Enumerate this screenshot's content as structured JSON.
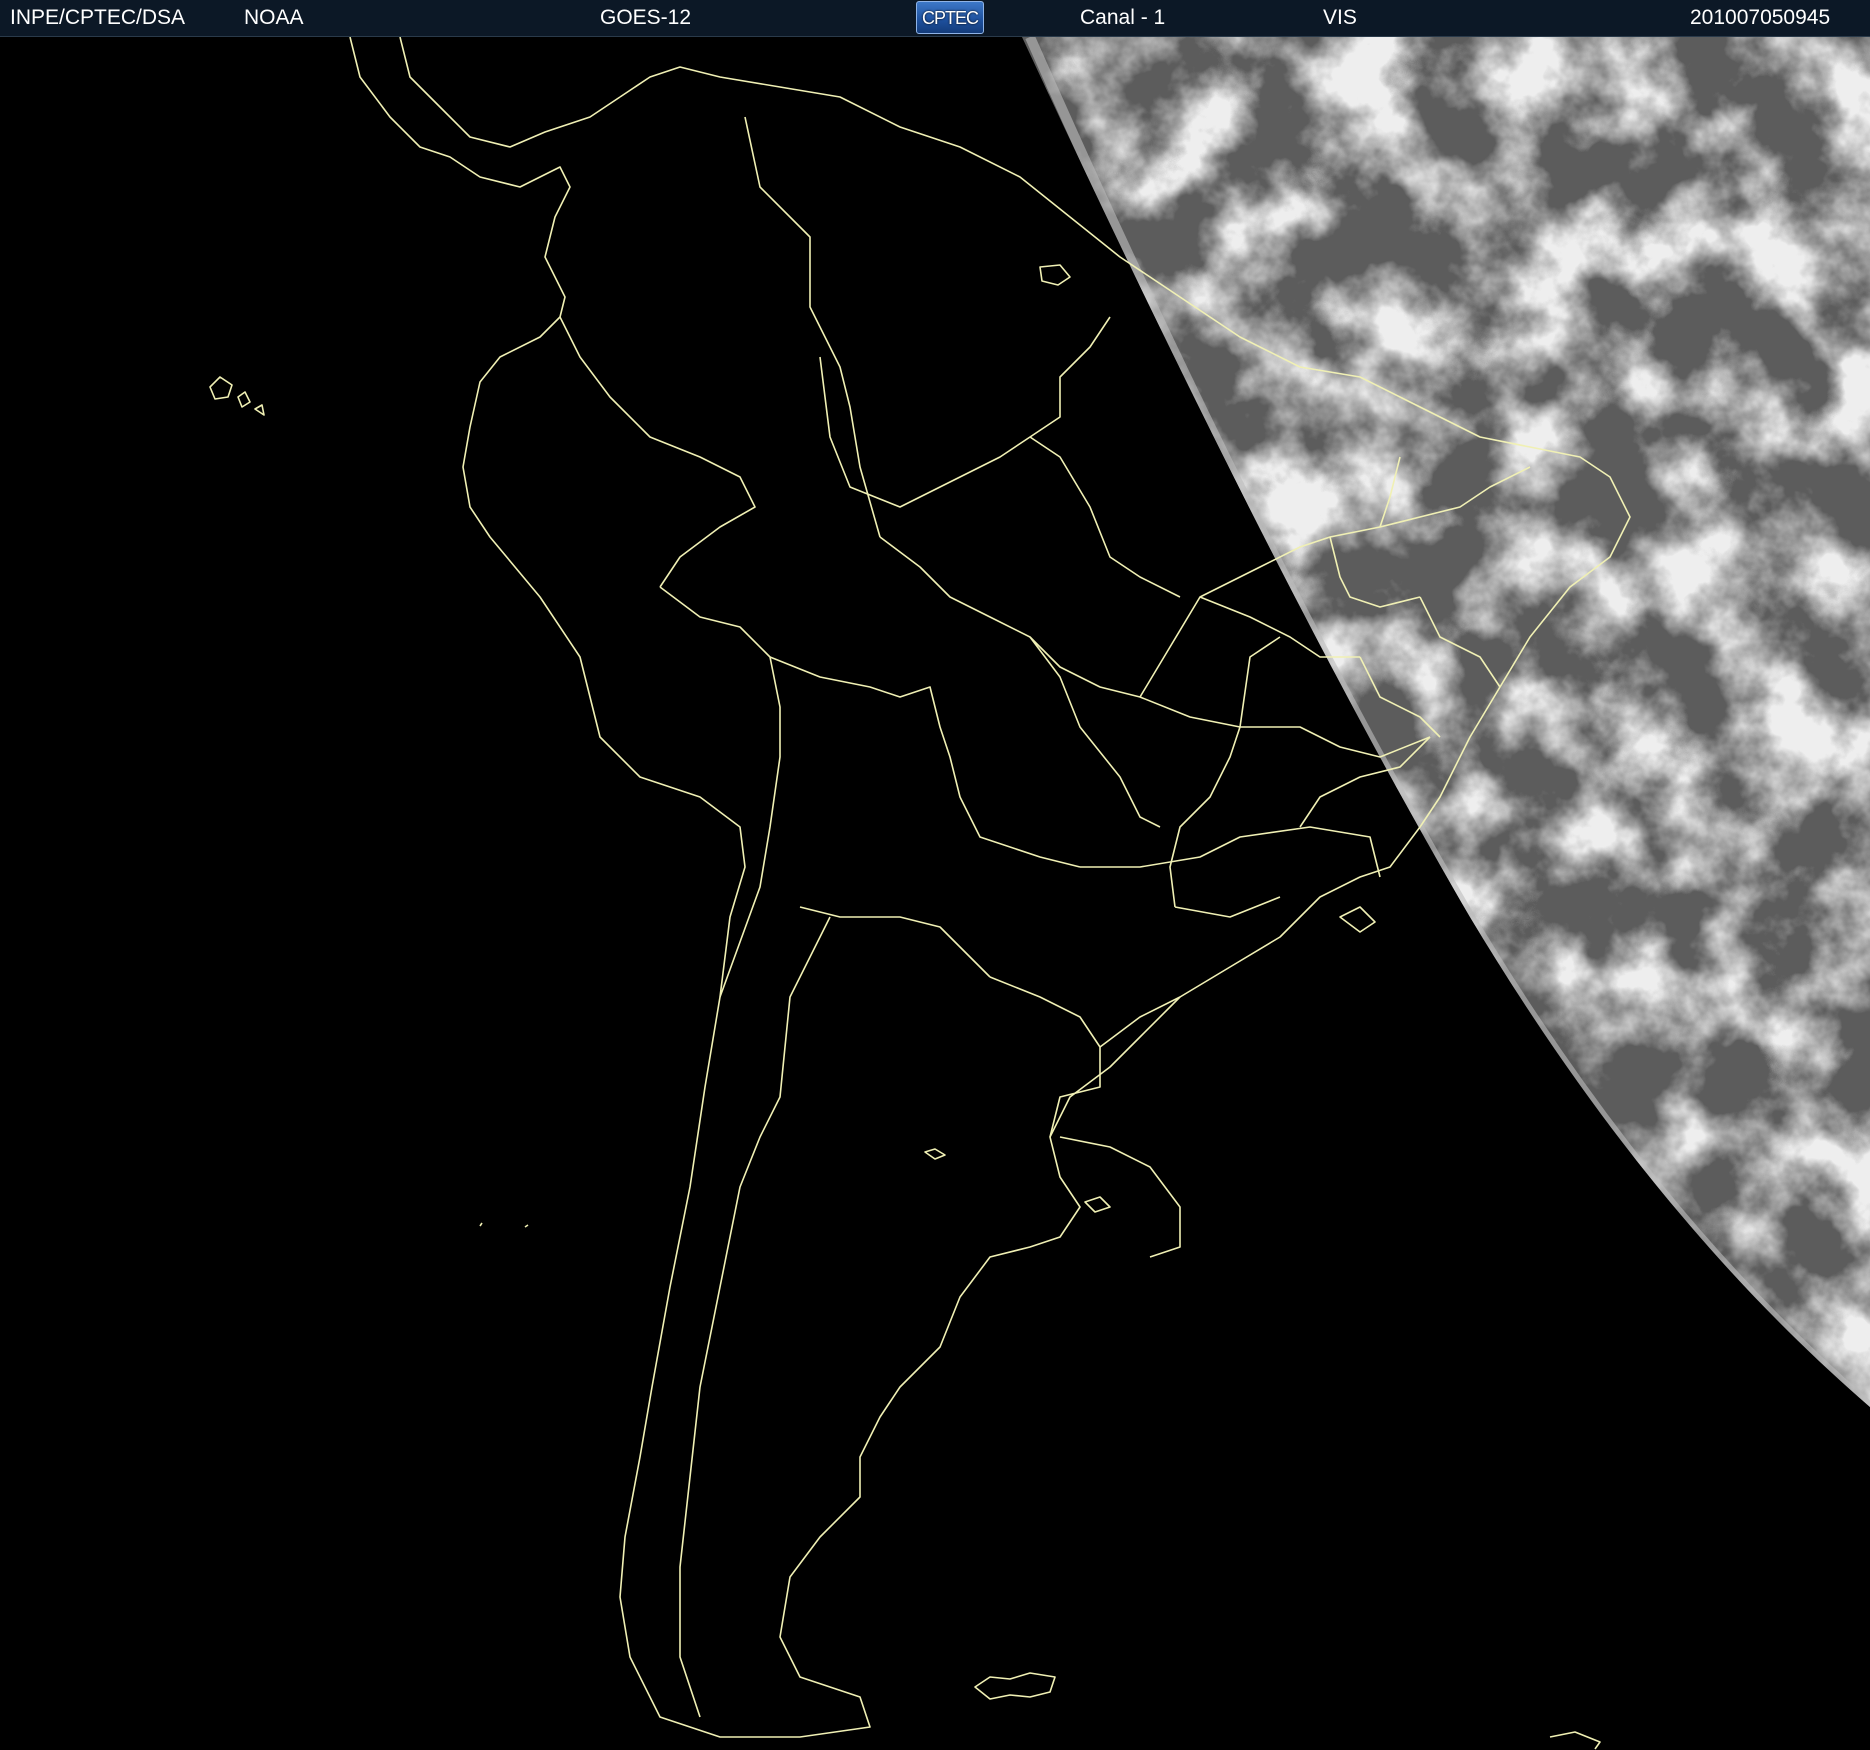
{
  "header": {
    "agency": "INPE/CPTEC/DSA",
    "provider": "NOAA",
    "satellite": "GOES-12",
    "logo_text": "CPTEC",
    "channel": "Canal - 1",
    "band": "VIS",
    "timestamp": "201007050945"
  },
  "map": {
    "region": "south-america",
    "background_color": "#000000",
    "border_color": "#f0f0b4",
    "cloud_color": "#d8d8d8",
    "daylit_color": "#5a5a5a"
  }
}
